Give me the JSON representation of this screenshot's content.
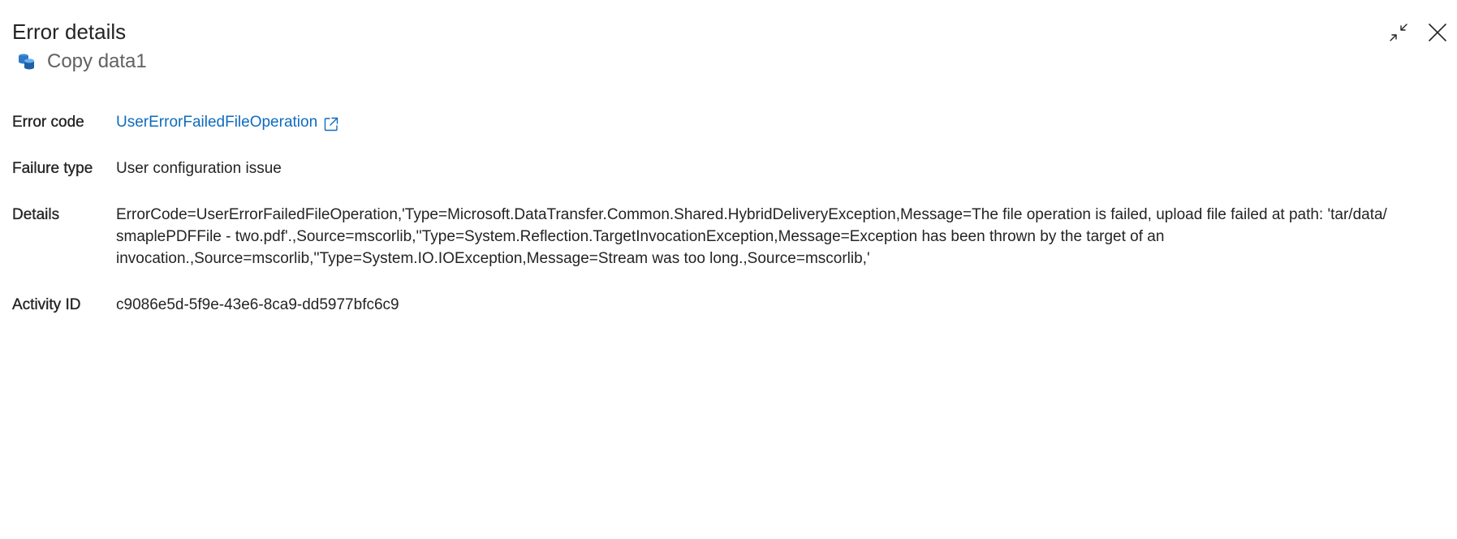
{
  "header": {
    "title": "Error details",
    "activity_name": "Copy data1",
    "activity_icon": "copy-data-icon",
    "minimize_icon": "minimize-icon",
    "close_icon": "close-icon"
  },
  "fields": {
    "error_code": {
      "label": "Error code",
      "value": "UserErrorFailedFileOperation",
      "link_icon": "external-link-icon"
    },
    "failure_type": {
      "label": "Failure type",
      "value": "User configuration issue"
    },
    "details": {
      "label": "Details",
      "value": "ErrorCode=UserErrorFailedFileOperation,'Type=Microsoft.DataTransfer.Common.Shared.HybridDeliveryException,Message=The file operation is failed, upload file failed at path: 'tar/data/ smaplePDFFile - two.pdf'.,Source=mscorlib,''Type=System.Reflection.TargetInvocationException,Message=Exception has been thrown by the target of an invocation.,Source=mscorlib,''Type=System.IO.IOException,Message=Stream was too long.,Source=mscorlib,'"
    },
    "activity_id": {
      "label": "Activity ID",
      "value": "c9086e5d-5f9e-43e6-8ca9-dd5977bfc6c9"
    }
  },
  "colors": {
    "link": "#0f6cbd",
    "text": "#242424",
    "subtitle": "#616161",
    "icon_accent": "#1a73c8"
  }
}
